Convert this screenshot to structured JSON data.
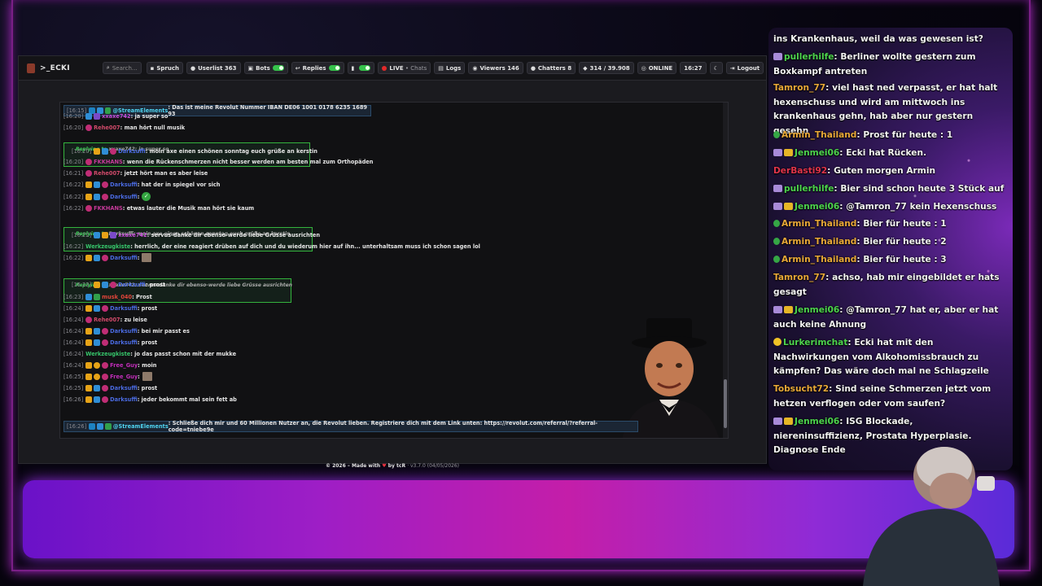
{
  "navbar": {
    "brand": ">_ECKI",
    "search_placeholder": "Search...",
    "spruch": "Spruch",
    "userlist": "Userlist",
    "userlist_count": "363",
    "bots": "Bots",
    "replies": "Replies",
    "live": "LIVE",
    "chats": "Chats",
    "logs": "Logs",
    "viewers": "Viewers",
    "viewers_count": "146",
    "chatters": "Chatters",
    "chatters_count": "8",
    "messages": "314 / 39.908",
    "online": "ONLINE",
    "time": "16:27",
    "logout": "Logout"
  },
  "chat": {
    "pinned_top": {
      "time": "[16:15]",
      "user": "@StreamElements",
      "text": ": Das ist meine Revolut Nummer IBAN DE06 1001 0178 6235 1689 93"
    },
    "pinned_bottom": {
      "time": "[16:26]",
      "user": "@StreamElements",
      "text": ": Schließe dich mir und 60 Millionen Nutzer an, die Revolut lieben. Registriere dich mit dem Link unten: https://revolut.com/referral/?referral-code=tniebe9e"
    },
    "rows": [
      {
        "time": "[16:20]",
        "user": "xxaxe742",
        "color": "#c44bd6",
        "text": ": ja super so"
      },
      {
        "time": "[16:20]",
        "user": "Rehe007",
        "color": "#d14a6a",
        "text": ": man hört null musik"
      },
      {
        "time": "[16:20]",
        "user": "Darksuffi",
        "color": "#4a6ae0",
        "text": ": moin axe einen schönen sonntag euch grüße an kerstin"
      },
      {
        "time": "[16:20]",
        "user": "FKKHANS",
        "color": "#c63a9a",
        "text": ": wenn die Rückenschmerzen nicht besser werden am besten mal zum Orthopäden"
      },
      {
        "time": "[16:21]",
        "user": "Rehe007",
        "color": "#d14a6a",
        "text": ": jetzt hört man es aber leise"
      },
      {
        "time": "[16:22]",
        "user": "Darksuffi",
        "color": "#4a6ae0",
        "text": ": hat der in spiegel vor sich"
      },
      {
        "time": "[16:22]",
        "user": "Darksuffi",
        "color": "#4a6ae0",
        "text": ":"
      },
      {
        "time": "[16:22]",
        "user": "FKKHANS",
        "color": "#c63a9a",
        "text": ": etwas lauter die Musik man hört sie kaum"
      },
      {
        "time": "[16:22]",
        "user": "xxaxe742",
        "color": "#c44bd6",
        "text": ": servus-danke dir ebenso-werde liebe Grüsse ausrichten"
      },
      {
        "time": "[16:22]",
        "user": "Werkzeugkiste",
        "color": "#36c46a",
        "text": ": herrlich, der eine reagiert drüben auf dich und du wiederum hier auf ihn... unterhaltsam muss ich schon sagen lol"
      },
      {
        "time": "[16:22]",
        "user": "Darksuffi",
        "color": "#4a6ae0",
        "text": ":"
      },
      {
        "time": "[16:23]",
        "user": "Darksuffi",
        "color": "#4a6ae0",
        "text": ": prost"
      },
      {
        "time": "[16:23]",
        "user": "musk_040",
        "color": "#e0443a",
        "text": ": Prost"
      },
      {
        "time": "[16:24]",
        "user": "Darksuffi",
        "color": "#4a6ae0",
        "text": ": prost"
      },
      {
        "time": "[16:24]",
        "user": "Rehe007",
        "color": "#d14a6a",
        "text": ": zu leise"
      },
      {
        "time": "[16:24]",
        "user": "Darksuffi",
        "color": "#4a6ae0",
        "text": ": bei mir passt es"
      },
      {
        "time": "[16:24]",
        "user": "Darksuffi",
        "color": "#4a6ae0",
        "text": ": prost"
      },
      {
        "time": "[16:24]",
        "user": "Werkzeugkiste",
        "color": "#36c46a",
        "text": ": jo das passt schon mit der mukke"
      },
      {
        "time": "[16:24]",
        "user": "Free_Guy",
        "color": "#c02db8",
        "text": ": moin"
      },
      {
        "time": "[16:25]",
        "user": "Free_Guy",
        "color": "#c02db8",
        "text": ":"
      },
      {
        "time": "[16:25]",
        "user": "Darksuffi",
        "color": "#4a6ae0",
        "text": ": prost"
      },
      {
        "time": "[16:26]",
        "user": "Darksuffi",
        "color": "#4a6ae0",
        "text": ": jeder bekommt mal sein fett ab"
      }
    ],
    "replies": [
      {
        "label": "Replying to",
        "ref": "xxaxe742: ja super so"
      },
      {
        "label": "Replying to",
        "ref": "Darksuffi: moin axe einen schönen sonntag euch grüße an kerstin"
      },
      {
        "label": "Replying to",
        "ref": "xxaxe742: servus-danke dir ebenso-werde liebe Grüsse ausrichten"
      }
    ]
  },
  "footer": {
    "copy": "© 2026 – Made with",
    "by": "by tcR",
    "version": "· v3.7.0 (04/05/2026)"
  },
  "side_chat": [
    {
      "badges": [],
      "user": "",
      "color": "#ffffff",
      "text": "ins Krankenhaus, weil da was gewesen ist?"
    },
    {
      "badges": [
        "gift"
      ],
      "user": "pullerhilfe",
      "color": "#4dd34d",
      "text": ": Berliner wollte gestern zum Boxkampf antreten"
    },
    {
      "badges": [],
      "user": "Tamron_77",
      "color": "#e8a838",
      "text": ": viel hast ned verpasst, er hat halt hexenschuss und wird am mittwoch ins krankenhaus gehn, hab aber nur gestern gesehn"
    },
    {
      "badges": [
        "mod"
      ],
      "user": "Armin_Thailand",
      "color": "#e8a838",
      "text": ": Prost für heute : 1"
    },
    {
      "badges": [
        "gift",
        "sub"
      ],
      "user": "Jenmei06",
      "color": "#4dd34d",
      "text": ": Ecki hat Rücken."
    },
    {
      "badges": [],
      "user": "DerBasti92",
      "color": "#e0344a",
      "text": ": Guten morgen Armin"
    },
    {
      "badges": [
        "gift"
      ],
      "user": "pullerhilfe",
      "color": "#4dd34d",
      "text": ": Bier sind schon heute 3 Stück auf"
    },
    {
      "badges": [
        "gift",
        "sub"
      ],
      "user": "Jenmei06",
      "color": "#4dd34d",
      "text": ": @Tamron_77 kein Hexenschuss",
      "mention": "@Tamron_77"
    },
    {
      "badges": [
        "mod"
      ],
      "user": "Armin_Thailand",
      "color": "#e8a838",
      "text": ": Bier für heute : 1"
    },
    {
      "badges": [
        "mod"
      ],
      "user": "Armin_Thailand",
      "color": "#e8a838",
      "text": ": Bier für heute : 2"
    },
    {
      "badges": [
        "mod"
      ],
      "user": "Armin_Thailand",
      "color": "#e8a838",
      "text": ": Bier für heute : 3"
    },
    {
      "badges": [],
      "user": "Tamron_77",
      "color": "#e8a838",
      "text": ": achso, hab mir eingebildet er hats gesagt"
    },
    {
      "badges": [
        "gift",
        "sub"
      ],
      "user": "Jenmei06",
      "color": "#4dd34d",
      "text": ": @Tamron_77 hat er, aber er hat auch keine Ahnung"
    },
    {
      "badges": [
        "yellow"
      ],
      "user": "Lurkerimchat",
      "color": "#4dd34d",
      "text": ": Ecki hat mit den Nachwirkungen vom Alkohomissbrauch zu kämpfen? Das wäre doch mal ne Schlagzeile"
    },
    {
      "badges": [],
      "user": "Tobsucht72",
      "color": "#e8a838",
      "text": ": Sind seine Schmerzen jetzt vom hetzen verflogen oder vom saufen?"
    },
    {
      "badges": [
        "gift",
        "sub"
      ],
      "user": "Jenmei06",
      "color": "#4dd34d",
      "text": ": ISG Blockade, niereninsuffizienz, Prostata Hyperplasie. Diagnose Ende"
    }
  ]
}
